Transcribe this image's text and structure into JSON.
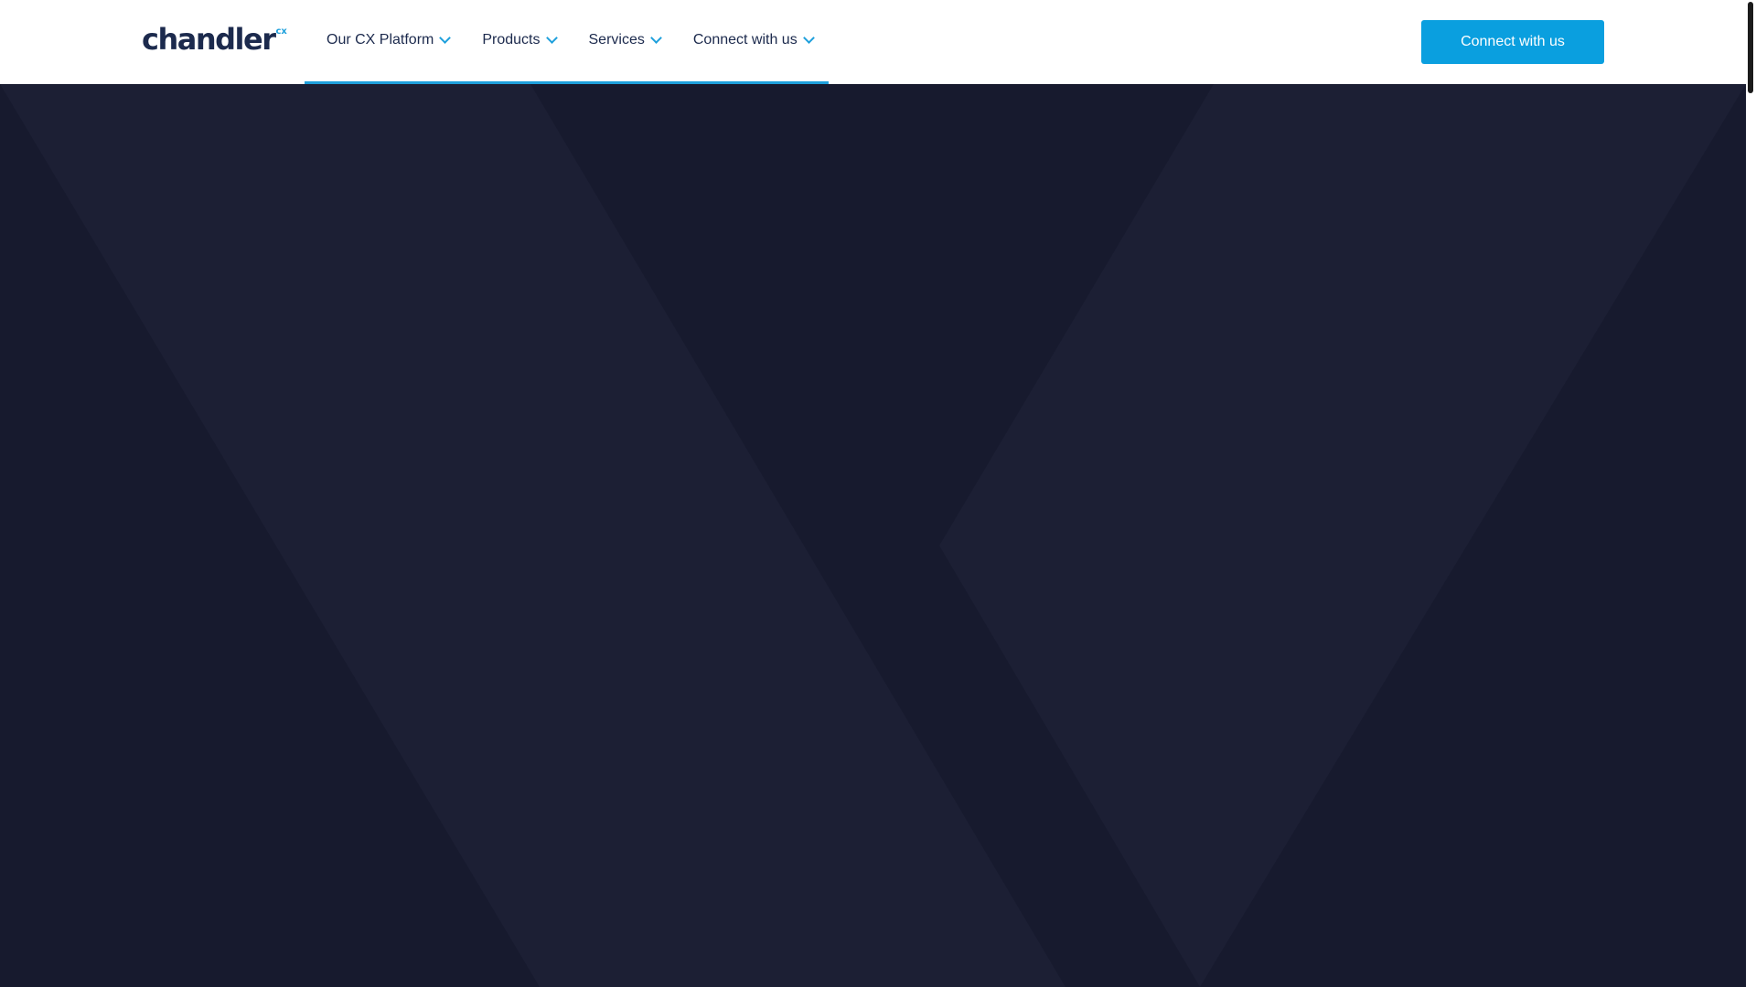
{
  "brand": {
    "name": "chandler",
    "superscript": "cx",
    "colors": {
      "navy": "#1c2a4d",
      "accent": "#1ea0dc",
      "hero_bg": "#171a2e"
    }
  },
  "nav": {
    "items": [
      {
        "label": "Our CX Platform",
        "icon": "chevron-down-icon"
      },
      {
        "label": "Products",
        "icon": "chevron-down-icon"
      },
      {
        "label": "Services",
        "icon": "chevron-down-icon"
      },
      {
        "label": "Connect with us",
        "icon": "chevron-down-icon"
      }
    ]
  },
  "cta": {
    "label": "Connect with us"
  }
}
